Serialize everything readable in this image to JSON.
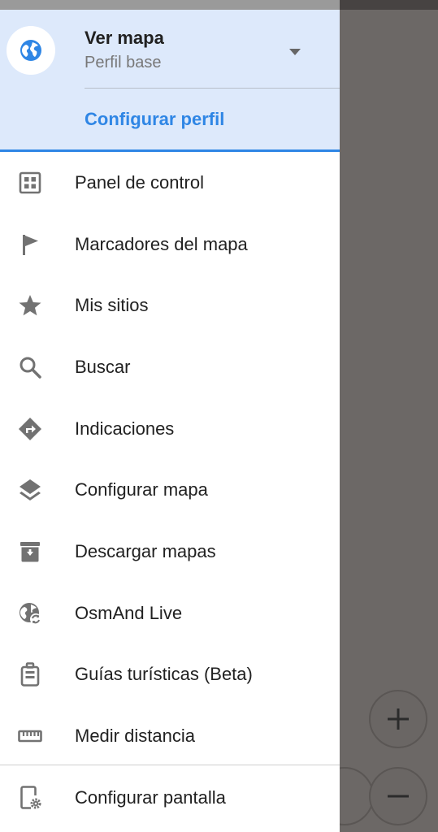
{
  "header": {
    "profile_name": "Ver mapa",
    "profile_subtitle": "Perfil base",
    "configure_profile": "Configurar perfil",
    "accent_color": "#2f86e5",
    "background_color": "#dde9fb",
    "avatar_icon": "globe-icon",
    "dropdown_icon": "caret-down-icon"
  },
  "menu": {
    "items": [
      {
        "label": "Panel de control",
        "icon": "dashboard-icon"
      },
      {
        "label": "Marcadores del mapa",
        "icon": "flag-icon"
      },
      {
        "label": "Mis sitios",
        "icon": "star-icon"
      },
      {
        "label": "Buscar",
        "icon": "search-icon"
      },
      {
        "label": "Indicaciones",
        "icon": "directions-icon"
      },
      {
        "label": "Configurar mapa",
        "icon": "layers-icon"
      },
      {
        "label": "Descargar mapas",
        "icon": "download-box-icon"
      },
      {
        "label": "OsmAnd Live",
        "icon": "globe-sync-icon"
      },
      {
        "label": "Guías turísticas (Beta)",
        "icon": "travel-guide-icon"
      },
      {
        "label": "Medir distancia",
        "icon": "ruler-icon"
      }
    ],
    "bottom_item": {
      "label": "Configurar pantalla",
      "icon": "screen-settings-icon"
    }
  },
  "map": {
    "zoom_in_icon": "plus-icon",
    "zoom_out_icon": "minus-icon"
  }
}
